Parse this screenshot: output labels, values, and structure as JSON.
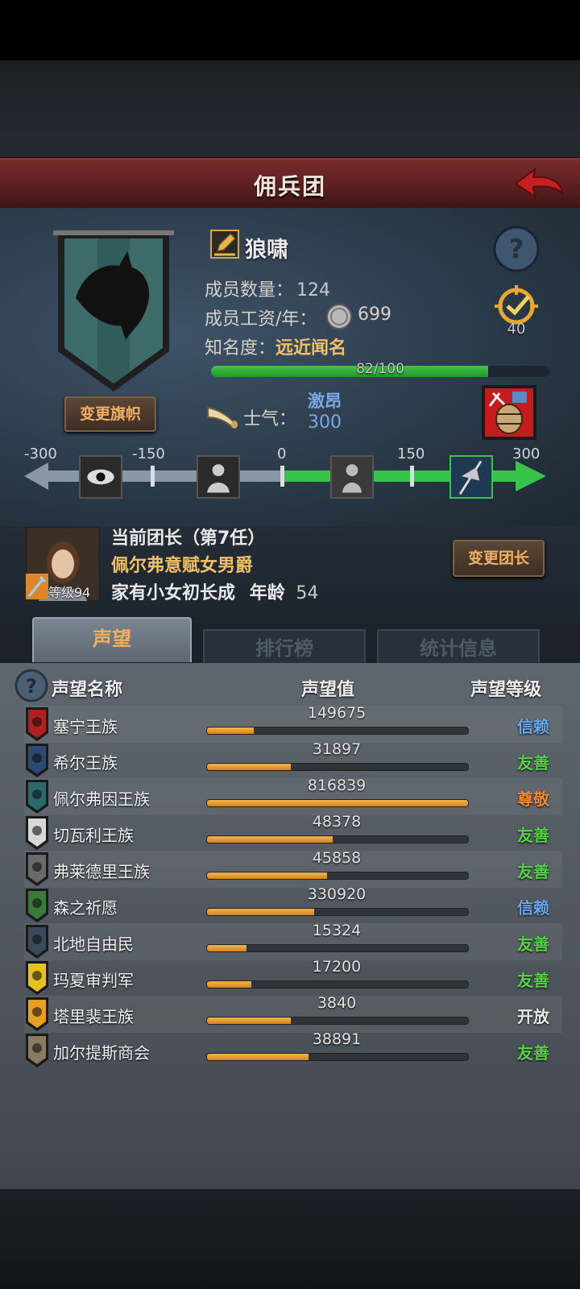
{
  "header": {
    "title": "佣兵团"
  },
  "guild": {
    "name": "狼啸",
    "members_label": "成员数量：",
    "members_value": "124",
    "salary_label": "成员工资/年：",
    "salary_value": "699",
    "fame_label": "知名度：",
    "fame_value": "远近闻名",
    "fame_progress_text": "82/100",
    "fame_progress": 0.82,
    "badge_count": "40",
    "change_banner_label": "变更旗帜"
  },
  "morale": {
    "label": "士气：",
    "state": "激昂",
    "value": "300",
    "scale_labels": [
      "-300",
      "-150",
      "0",
      "150",
      "300"
    ]
  },
  "leader": {
    "title": "当前团长（第7任）",
    "name": "佩尔弗意赋女男爵",
    "trait": "家有小女初长成",
    "age_label": "年龄",
    "age_value": "54",
    "level_text": "等级94",
    "change_leader_label": "变更团长"
  },
  "tabs": [
    {
      "label": "声望"
    },
    {
      "label": "排行榜"
    },
    {
      "label": "统计信息"
    }
  ],
  "table": {
    "col_name": "声望名称",
    "col_value": "声望值",
    "col_level": "声望等级",
    "rows": [
      {
        "name": "塞宁王族",
        "value": "149675",
        "fill": 0.18,
        "level": "信赖",
        "level_color": "#6aa7ee"
      },
      {
        "name": "希尔王族",
        "value": "31897",
        "fill": 0.32,
        "level": "友善",
        "level_color": "#5ad04a"
      },
      {
        "name": "佩尔弗因王族",
        "value": "816839",
        "fill": 1.0,
        "level": "尊敬",
        "level_color": "#f08a2a"
      },
      {
        "name": "切瓦利王族",
        "value": "48378",
        "fill": 0.48,
        "level": "友善",
        "level_color": "#5ad04a"
      },
      {
        "name": "弗莱德里王族",
        "value": "45858",
        "fill": 0.46,
        "level": "友善",
        "level_color": "#5ad04a"
      },
      {
        "name": "森之祈愿",
        "value": "330920",
        "fill": 0.41,
        "level": "信赖",
        "level_color": "#6aa7ee"
      },
      {
        "name": "北地自由民",
        "value": "15324",
        "fill": 0.15,
        "level": "友善",
        "level_color": "#5ad04a"
      },
      {
        "name": "玛夏审判军",
        "value": "17200",
        "fill": 0.17,
        "level": "友善",
        "level_color": "#5ad04a"
      },
      {
        "name": "塔里裴王族",
        "value": "3840",
        "fill": 0.32,
        "level": "开放",
        "level_color": "#e8e8e8"
      },
      {
        "name": "加尔提斯商会",
        "value": "38891",
        "fill": 0.39,
        "level": "友善",
        "level_color": "#5ad04a"
      }
    ]
  }
}
